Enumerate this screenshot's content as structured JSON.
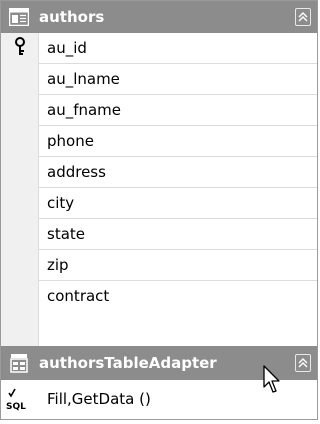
{
  "table": {
    "title": "authors",
    "icon": "table-icon",
    "columns": [
      {
        "label": "au_id",
        "is_primary_key": true
      },
      {
        "label": "au_lname"
      },
      {
        "label": "au_fname"
      },
      {
        "label": "phone"
      },
      {
        "label": "address"
      },
      {
        "label": "city"
      },
      {
        "label": "state"
      },
      {
        "label": "zip"
      },
      {
        "label": "contract"
      }
    ]
  },
  "adapter": {
    "title": "authorsTableAdapter",
    "icon": "table-adapter-icon",
    "methods": [
      {
        "label": "Fill,GetData ()",
        "icon": "sql-query-icon"
      }
    ]
  },
  "colors": {
    "header_bg": "#8c8c8c",
    "header_text": "#ffffff",
    "strip_bg": "#f0f0f0",
    "border": "#9a9a9a"
  }
}
